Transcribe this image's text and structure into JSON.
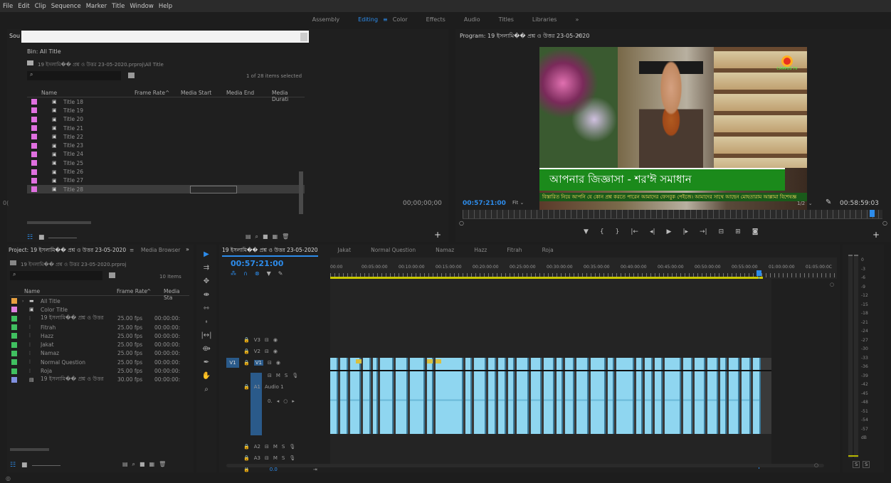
{
  "menu": [
    "File",
    "Edit",
    "Clip",
    "Sequence",
    "Marker",
    "Title",
    "Window",
    "Help"
  ],
  "workspaces": [
    {
      "label": "Assembly",
      "active": false
    },
    {
      "label": "Editing",
      "active": true
    },
    {
      "label": "Color",
      "active": false
    },
    {
      "label": "Effects",
      "active": false
    },
    {
      "label": "Audio",
      "active": false
    },
    {
      "label": "Titles",
      "active": false
    },
    {
      "label": "Libraries",
      "active": false
    },
    {
      "label": "»",
      "active": false
    }
  ],
  "source": {
    "tab": "Sou",
    "timecode": "00;00;00;00",
    "bin_title": "Bin: All Title",
    "path": "19 ইসলামি�� প্রশ্ন ও উত্তর 23-05-2020.prproj\\All Title",
    "selected": "1 of 28 items selected",
    "cols": [
      "Name",
      "Frame Rate",
      "Media Start",
      "Media End",
      "Media Durati"
    ],
    "items": [
      "Title 18",
      "Title 19",
      "Title 20",
      "Title 21",
      "Title 22",
      "Title 23",
      "Title 24",
      "Title 25",
      "Title 26",
      "Title 27",
      "Title 28"
    ]
  },
  "program": {
    "title": "Program: 19 ইসলামি�� প্রশ্ন ও উত্তর 23-05-2020",
    "tc": "00:57:21:00",
    "fit": "Fit",
    "res": "1/2",
    "dur": "00:58:59:03",
    "lower_third": "আপনার জিজ্ঞাসা - শর'ঈ সমাধান",
    "ticker": "বিস্তারিত নিয়ে আপনি যে কোন প্রশ্ন করতে পারেন আমাদের ফেসবুক পেইজে। আমাদের সাথে আছেন মোহতারাম আল্লামা বিশেষজ্ঞ",
    "logo": "CAMPUS TV"
  },
  "project": {
    "title": "Project: 19 ইসলামি�� প্রশ্ন ও উত্তর 23-05-2020",
    "tab2": "Media Browser",
    "file": "19 ইসলামি�� প্রশ্ন ও উত্তর 23-05-2020.prproj",
    "count": "10 Items",
    "cols": [
      "Name",
      "Frame Rate",
      "Media Sta"
    ],
    "items": [
      {
        "name": "All Title",
        "fr": "",
        "ms": "",
        "color": "#e8a040",
        "icon": "folder-icon"
      },
      {
        "name": "Color Title",
        "fr": "",
        "ms": "",
        "color": "#e080e0",
        "icon": "title-icon"
      },
      {
        "name": "19 ইসলামি�� প্রশ্ন ও উত্তর",
        "fr": "25.00 fps",
        "ms": "00:00:00:",
        "color": "#40c060",
        "icon": "sequence-icon"
      },
      {
        "name": "Fitrah",
        "fr": "25.00 fps",
        "ms": "00:00:00:",
        "color": "#40c060",
        "icon": "sequence-icon"
      },
      {
        "name": "Hazz",
        "fr": "25.00 fps",
        "ms": "00:00:00:",
        "color": "#40c060",
        "icon": "sequence-icon"
      },
      {
        "name": "Jakat",
        "fr": "25.00 fps",
        "ms": "00:00:00:",
        "color": "#40c060",
        "icon": "sequence-icon"
      },
      {
        "name": "Namaz",
        "fr": "25.00 fps",
        "ms": "00:00:00:",
        "color": "#40c060",
        "icon": "sequence-icon"
      },
      {
        "name": "Normal Question",
        "fr": "25.00 fps",
        "ms": "00:00:00:",
        "color": "#40c060",
        "icon": "sequence-icon"
      },
      {
        "name": "Roja",
        "fr": "25.00 fps",
        "ms": "00:00:00:",
        "color": "#40c060",
        "icon": "sequence-icon"
      },
      {
        "name": "19 ইসলামি�� প্রশ্ন ও উত্তর",
        "fr": "30.00 fps",
        "ms": "00:00:00:",
        "color": "#8090e0",
        "icon": "video-clip-icon"
      }
    ]
  },
  "timeline": {
    "tabs": [
      "19 ইসলামি�� প্রশ্ন ও উত্তর 23-05-2020",
      "Jakat",
      "Normal Question",
      "Namaz",
      "Hazz",
      "Fitrah",
      "Roja"
    ],
    "tc": "00:57:21:00",
    "ruler": [
      "00:00",
      "00:05:00:00",
      "00:10:00:00",
      "00:15:00:00",
      "00:20:00:00",
      "00:25:00:00",
      "00:30:00:00",
      "00:35:00:00",
      "00:40:00:00",
      "00:45:00:00",
      "00:50:00:00",
      "00:55:00:00",
      "01:00:00:00",
      "01:05:00:0C"
    ],
    "tracks": {
      "v3": "V3",
      "v2": "V2",
      "v1": "V1",
      "a1": "A1",
      "a1name": "Audio 1",
      "a2": "A2",
      "a3": "A3",
      "vol": "0.0"
    }
  },
  "meter": [
    "0",
    "-3",
    "-6",
    "-9",
    "-12",
    "-15",
    "-18",
    "-21",
    "-24",
    "-27",
    "-30",
    "-33",
    "-36",
    "-39",
    "-42",
    "-45",
    "-48",
    "-51",
    "-54",
    "-57",
    "dB"
  ],
  "meter_solo": [
    "S",
    "S"
  ],
  "icons": {
    "ripple": "ripple-icon",
    "select": "selection-tool-icon"
  }
}
